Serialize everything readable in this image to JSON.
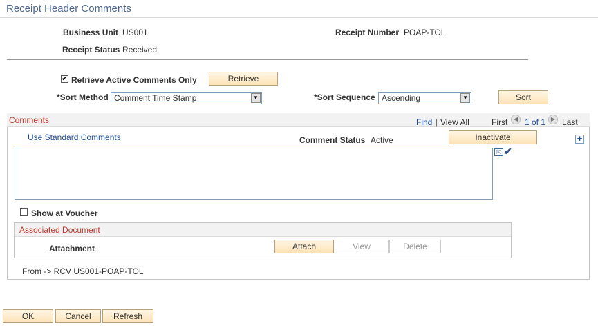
{
  "page": {
    "title": "Receipt Header Comments"
  },
  "header": {
    "business_unit_label": "Business Unit",
    "business_unit_value": "US001",
    "receipt_number_label": "Receipt Number",
    "receipt_number_value": "POAP-TOL",
    "receipt_status_label": "Receipt Status",
    "receipt_status_value": "Received"
  },
  "filters": {
    "retrieve_active_label": "Retrieve Active Comments Only",
    "retrieve_active_checked": true,
    "retrieve_button": "Retrieve",
    "sort_method_label": "*Sort Method",
    "sort_method_value": "Comment Time Stamp",
    "sort_sequence_label": "*Sort Sequence",
    "sort_sequence_value": "Ascending",
    "sort_button": "Sort"
  },
  "comments": {
    "section_title": "Comments",
    "find_link": "Find",
    "separator": "|",
    "view_all_link": "View All",
    "first_label": "First",
    "pager_text": "1 of 1",
    "last_label": "Last",
    "use_standard_link": "Use Standard Comments",
    "status_label": "Comment Status",
    "status_value": "Active",
    "inactivate_button": "Inactivate",
    "comment_text": "",
    "show_at_voucher_label": "Show at Voucher",
    "show_at_voucher_checked": false,
    "associated_document_title": "Associated Document",
    "attachment_label": "Attachment",
    "attach_button": "Attach",
    "view_button": "View",
    "delete_button": "Delete",
    "from_text": "From -> RCV US001-POAP-TOL"
  },
  "footer": {
    "ok_button": "OK",
    "cancel_button": "Cancel",
    "refresh_button": "Refresh"
  }
}
